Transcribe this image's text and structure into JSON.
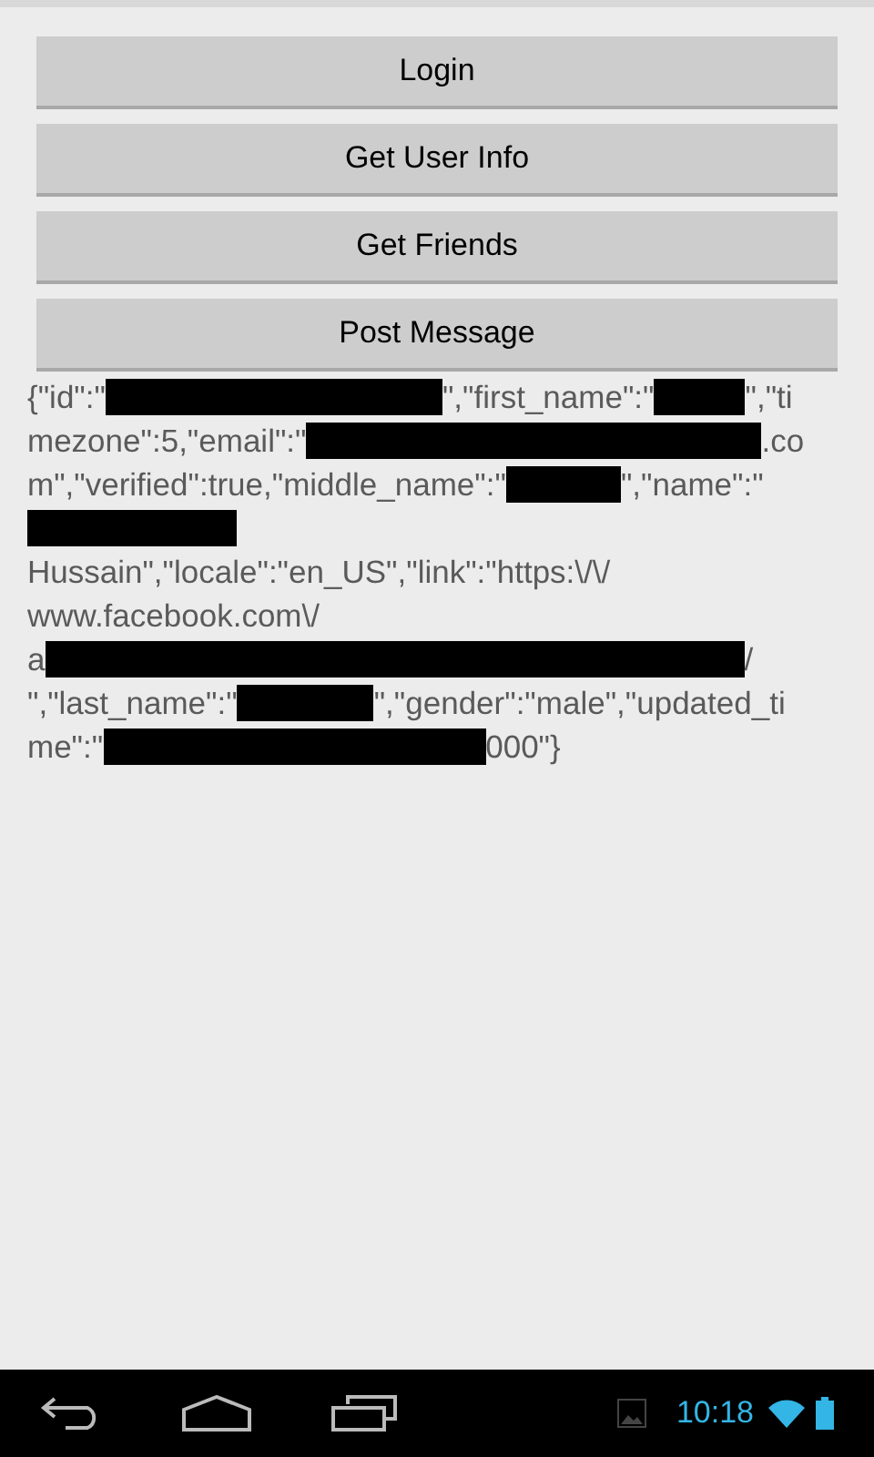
{
  "buttons": [
    "Login",
    "Get User Info",
    "Get Friends",
    "Post Message"
  ],
  "response_lines": [
    [
      {
        "kind": "text",
        "text": "{\"id\":\""
      },
      {
        "kind": "redaction"
      },
      {
        "kind": "text",
        "text": "\",\"first_name\":\""
      },
      {
        "kind": "redaction"
      },
      {
        "kind": "text",
        "text": "\",\"ti"
      }
    ],
    [
      {
        "kind": "text",
        "text": "mezone\":5,\"email\":\""
      },
      {
        "kind": "redaction"
      },
      {
        "kind": "text",
        "text": ".co"
      }
    ],
    [
      {
        "kind": "text",
        "text": "m\",\"verified\":true,\"middle_name\":\""
      },
      {
        "kind": "redaction"
      },
      {
        "kind": "text",
        "text": "\",\"name\":\""
      }
    ],
    [
      {
        "kind": "redaction"
      }
    ],
    [
      {
        "kind": "text",
        "text": "Hussain\",\"locale\":\"en_US\",\"link\":\"https:\\/\\/"
      }
    ],
    [
      {
        "kind": "text",
        "text": "www.facebook.com\\/"
      }
    ],
    [
      {
        "kind": "text",
        "text": "a"
      },
      {
        "kind": "redaction"
      },
      {
        "kind": "text",
        "text": "/"
      }
    ],
    [
      {
        "kind": "text",
        "text": "\",\"last_name\":\""
      },
      {
        "kind": "redaction"
      },
      {
        "kind": "text",
        "text": "\",\"gender\":\"male\",\"updated_ti"
      }
    ],
    [
      {
        "kind": "text",
        "text": "me\":\""
      },
      {
        "kind": "redaction"
      },
      {
        "kind": "text",
        "text": "000\"}"
      }
    ]
  ],
  "nav_bar": {
    "clock": "10:18"
  }
}
